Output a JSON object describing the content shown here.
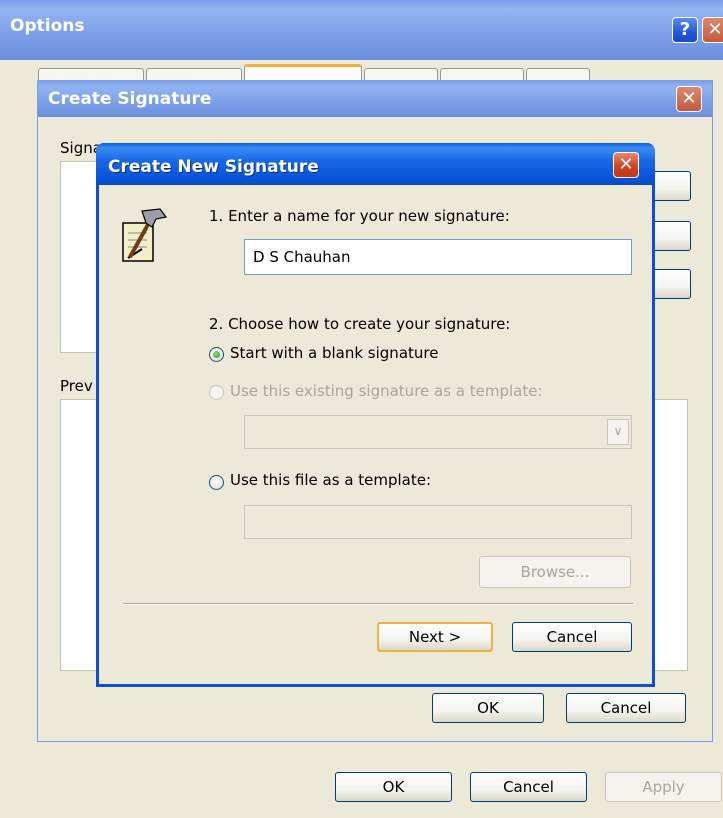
{
  "options_window": {
    "title": "Options",
    "help_glyph": "?",
    "close_glyph": "✕",
    "ok_label": "OK",
    "cancel_label": "Cancel",
    "apply_label": "Apply"
  },
  "create_signature_window": {
    "title": "Create Signature",
    "close_glyph": "✕",
    "signature_label_partial": "Signa",
    "preview_label_partial": "Prev",
    "ok_label": "OK",
    "cancel_label": "Cancel"
  },
  "new_signature_dialog": {
    "title": "Create New Signature",
    "close_glyph": "✕",
    "icon": "signature-wizard-icon",
    "step1_label": "1. Enter a name for your new signature:",
    "name_value": "D S Chauhan",
    "step2_label": "2. Choose how to create your signature:",
    "option_blank": "Start with a blank signature",
    "option_existing": "Use this existing signature as a template:",
    "option_file": "Use this file as a template:",
    "selected_option": "blank",
    "browse_label": "Browse...",
    "next_label": "Next >",
    "cancel_label": "Cancel"
  },
  "colors": {
    "xp_blue": "#0551d6",
    "dialog_face": "#ece9d8",
    "default_button_border": "#f2b13c",
    "disabled_text": "#a7a69a"
  }
}
